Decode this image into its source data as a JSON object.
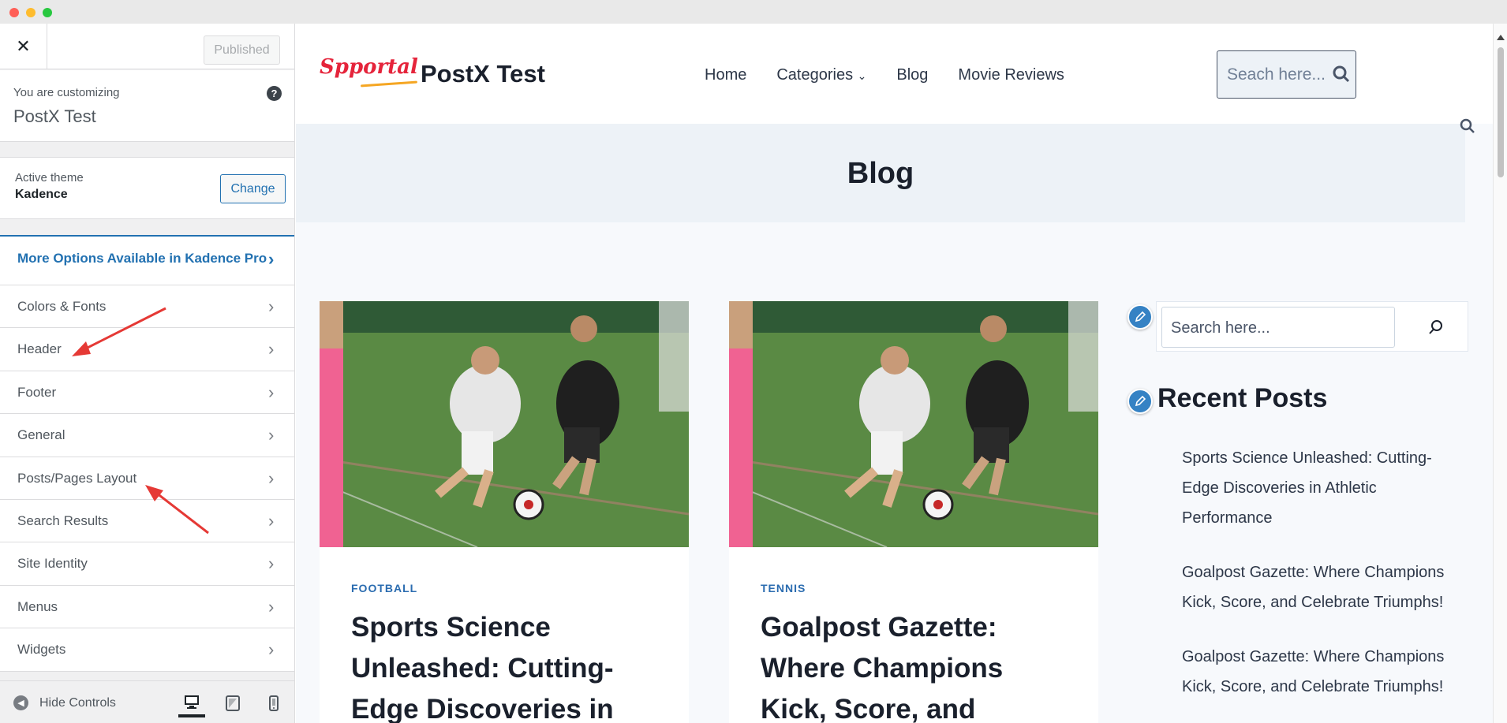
{
  "sidebar": {
    "published_label": "Published",
    "customizing_label": "You are customizing",
    "customizing_site": "PostX Test",
    "active_theme_label": "Active theme",
    "active_theme_name": "Kadence",
    "change_label": "Change",
    "pro_label": "More Options Available in Kadence Pro",
    "items": [
      {
        "label": "Colors & Fonts"
      },
      {
        "label": "Header"
      },
      {
        "label": "Footer"
      },
      {
        "label": "General"
      },
      {
        "label": "Posts/Pages Layout"
      },
      {
        "label": "Search Results"
      },
      {
        "label": "Site Identity"
      },
      {
        "label": "Menus"
      },
      {
        "label": "Widgets"
      }
    ],
    "hide_controls_label": "Hide Controls"
  },
  "site": {
    "logo_text": "Spportal",
    "title": "PostX Test",
    "nav": [
      "Home",
      "Categories",
      "Blog",
      "Movie Reviews"
    ],
    "header_search_placeholder": "Seach here...",
    "page_title": "Blog",
    "posts": [
      {
        "category": "FOOTBALL",
        "title": "Sports Science Unleashed: Cutting-Edge Discoveries in"
      },
      {
        "category": "TENNIS",
        "title": "Goalpost Gazette: Where Champions Kick, Score, and"
      }
    ],
    "widget_search_placeholder": "Search here...",
    "recent_posts_title": "Recent Posts",
    "recent_posts": [
      "Sports Science Unleashed: Cutting-Edge Discoveries in Athletic Performance",
      "Goalpost Gazette: Where Champions Kick, Score, and Celebrate Triumphs!",
      "Goalpost Gazette: Where Champions Kick, Score, and Celebrate Triumphs!"
    ]
  },
  "colors": {
    "accent": "#2271b1",
    "annotation_arrow": "#e53935",
    "logo": "#e5243b"
  }
}
